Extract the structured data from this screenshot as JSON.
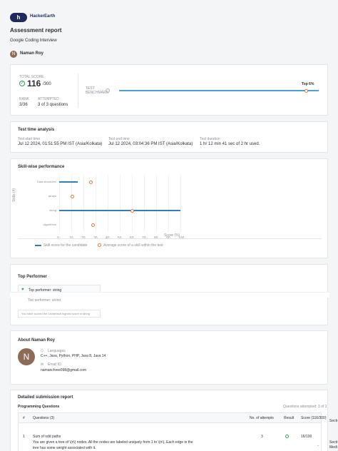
{
  "header": {
    "brand": "HackerEarth",
    "report_title": "Assessment report",
    "test_name": "Google Coding Interview",
    "candidate_initial": "N",
    "candidate_name": "Naman Roy"
  },
  "score_card": {
    "total_label": "TOTAL SCORE",
    "score": "116",
    "score_max": "/300",
    "rank_label": "RANK",
    "rank_value": "3/36",
    "attempted_label": "ATTEMPTED",
    "attempted_value": "3 of 3 questions",
    "benchmark_label": "TEST BENCHMARK",
    "top_badge": "Top 6%",
    "benchmark_fraction": 0.94
  },
  "test_time": {
    "title": "Test time analysis",
    "start_label": "Test start time",
    "start_value": "Jul 12 2024, 01:51:55 PM IST (Asia/Kolkata)",
    "end_label": "Test end time",
    "end_value": "Jul 12 2024, 03:04:36 PM IST (Asia/Kolkata)",
    "duration_label": "Test duration",
    "duration_value": "1 hr 12 min 41 sec of 2 hr used."
  },
  "skills": {
    "title": "Skill-wise performance",
    "y_axis_label": "Skills (4)",
    "x_axis_label": "Score (%)",
    "legend_candidate": "Skill score for the candidate",
    "legend_average": "Average score of a skill within the test"
  },
  "chart_data": {
    "type": "bar",
    "categories": [
      "Data structures",
      "arrays",
      "string",
      "algorithms"
    ],
    "series": [
      {
        "name": "Skill score for the candidate",
        "values": [
          15,
          0,
          100,
          0
        ]
      },
      {
        "name": "Average score of a skill within the test",
        "values": [
          26,
          11,
          60,
          28
        ]
      }
    ],
    "xticks": [
      "0",
      "10",
      "20",
      "30",
      "40",
      "50",
      "60",
      "70",
      "80",
      "90",
      "100"
    ],
    "xlim": [
      0,
      100
    ],
    "xlabel": "Score (%)",
    "ylabel": "Skills (4)",
    "legend_position": "bottom"
  },
  "top_performer": {
    "title": "Top Performer",
    "badge": "Top performer: string",
    "badge_repeat": "Top performer: string",
    "note": "You have scored the 1st/default highest score in string"
  },
  "about": {
    "title": "About Naman Roy",
    "avatar_initial": "N",
    "languages_label": "Languages",
    "languages_value": "C++, Java, Python, PHP, Java 8, Java 14",
    "email_label": "Email ID",
    "email_value": "namanchree098@gmail.com"
  },
  "submission": {
    "title": "Detailed submission report",
    "section_label": "Programming Questions",
    "attempted": "Questions attempted: 3 of 3",
    "columns": [
      "#",
      "Questions (3)",
      "No. of attempts",
      "Result",
      "Score (116/300)"
    ],
    "rows": [
      {
        "num": "1",
        "name": "Sum of odd paths",
        "desc1": "You are given a tree of \\(n\\) nodes. All the nodes are labeled uniquely from 1 to \\(n\\). Each edge in the",
        "desc2": "tree has some weight associated with it.",
        "attempts": "3",
        "score": "16/100"
      }
    ],
    "side_label1": "Secti",
    "side_label2": "Secti",
    "side_label3": "Medi"
  },
  "colors": {
    "accent": "#2f7fc1",
    "average": "#e07b39",
    "success": "#2ea44f"
  }
}
